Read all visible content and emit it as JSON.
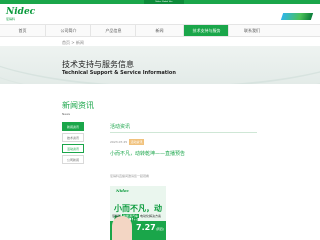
{
  "topbar": {
    "pill_label": "Nidec Global Site"
  },
  "brand": {
    "logo_text": "Nidec",
    "logo_sub": "尼得科"
  },
  "nav": {
    "items": [
      {
        "label": "首页",
        "active": false
      },
      {
        "label": "公司简介",
        "active": false
      },
      {
        "label": "产品信息",
        "active": false
      },
      {
        "label": "新闻",
        "active": false
      },
      {
        "label": "技术支持与服务",
        "active": true
      },
      {
        "label": "联系我们",
        "active": false
      }
    ]
  },
  "breadcrumb": {
    "home": "首页",
    "current": "新闻"
  },
  "hero": {
    "title": "技术支持与服务信息",
    "subtitle": "Technical Support & Service Information"
  },
  "sidebar": {
    "title": "新闻资讯",
    "subtitle": "News",
    "items": [
      {
        "label": "新闻资讯",
        "state": "head"
      },
      {
        "label": "技术资讯",
        "state": ""
      },
      {
        "label": "活动资讯",
        "state": "active"
      },
      {
        "label": "公司新闻",
        "state": ""
      }
    ]
  },
  "main": {
    "title": "活动资讯",
    "date": "2023.07.25",
    "tag": "活动资讯",
    "article_title": "小而不凡，动转乾坤——直播预告",
    "body_text": "尼得科直播间邀请您一起观看",
    "poster": {
      "logo": "Nidec",
      "headline": "小而不凡，动转乾坤",
      "sub_prefix": "尼得科",
      "sub_highlight": "新能源汽车",
      "sub_suffix": "电动化解决方案",
      "date": "7.27",
      "date_note": "(周四)"
    }
  },
  "colors": {
    "brand_green": "#1aa64a",
    "tag_orange": "#f1c27d",
    "hero_bg": "#eef3f1"
  }
}
